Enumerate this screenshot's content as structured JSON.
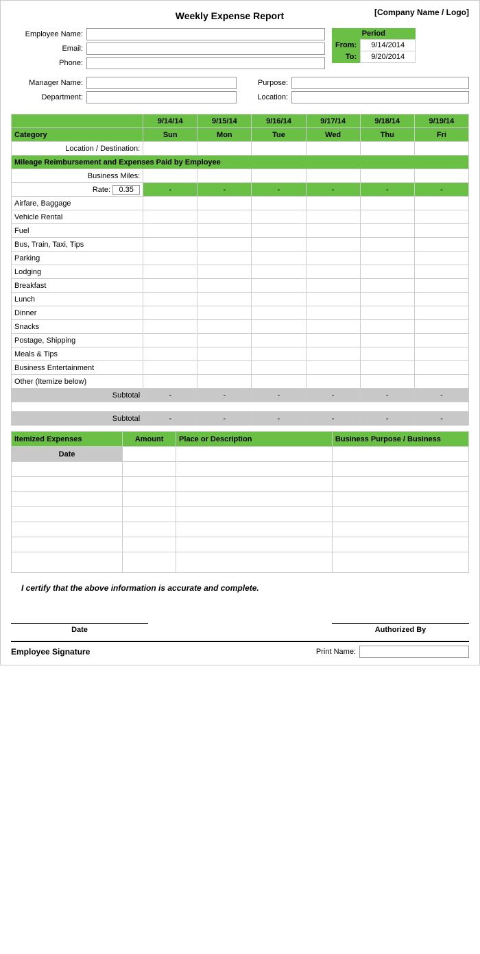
{
  "header": {
    "title": "Weekly Expense Report",
    "company": "[Company Name / Logo]"
  },
  "period": {
    "label": "Period",
    "from_label": "From:",
    "from_value": "9/14/2014",
    "to_label": "To:",
    "to_value": "9/20/2014"
  },
  "employee": {
    "name_label": "Employee Name:",
    "email_label": "Email:",
    "phone_label": "Phone:",
    "manager_label": "Manager Name:",
    "department_label": "Department:",
    "purpose_label": "Purpose:",
    "location_label": "Location:"
  },
  "table": {
    "category_label": "Category",
    "dates": [
      "9/14/14",
      "9/15/14",
      "9/16/14",
      "9/17/14",
      "9/18/14",
      "9/19/14"
    ],
    "days": [
      "Sun",
      "Mon",
      "Tue",
      "Wed",
      "Thu",
      "Fri"
    ],
    "location_row": "Location / Destination:",
    "mileage_section": "Mileage Reimbursement and Expenses Paid by Employee",
    "business_miles_label": "Business Miles:",
    "rate_label": "Rate:",
    "rate_value": "0.35",
    "dash": "-",
    "categories": [
      "Airfare, Baggage",
      "Vehicle Rental",
      "Fuel",
      "Bus, Train, Taxi, Tips",
      "Parking",
      "Lodging",
      "Breakfast",
      "Lunch",
      "Dinner",
      "Snacks",
      "Postage, Shipping",
      "Meals & Tips",
      "Business Entertainment",
      "Other (Itemize below)"
    ],
    "subtotal_label": "Subtotal"
  },
  "itemized": {
    "header": "Itemized Expenses",
    "amount_col": "Amount",
    "place_col": "Place or Description",
    "business_col": "Business Purpose / Business",
    "date_col": "Date",
    "rows": 7
  },
  "certification": {
    "text": "I certify that the above information is accurate and complete."
  },
  "signature": {
    "date_label": "Date",
    "authorized_label": "Authorized By",
    "employee_sig_label": "Employee Signature",
    "print_name_label": "Print Name:"
  }
}
